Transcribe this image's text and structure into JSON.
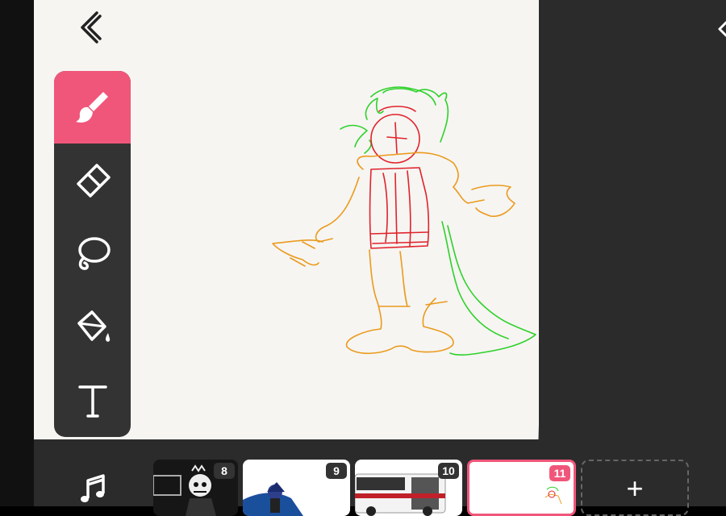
{
  "colors": {
    "accent": "#f0567a",
    "toolbar": "#333333",
    "panel": "#2b2b2b",
    "canvas": "#f6f5f2"
  },
  "navigation": {
    "back_icon": "chevron-left-icon",
    "panel_toggle_icon": "chevron-left-icon"
  },
  "toolbar": {
    "tools": [
      {
        "name": "brush",
        "icon": "brush-icon",
        "active": true
      },
      {
        "name": "eraser",
        "icon": "eraser-icon",
        "active": false
      },
      {
        "name": "lasso",
        "icon": "lasso-icon",
        "active": false
      },
      {
        "name": "fill",
        "icon": "paint-bucket-icon",
        "active": false
      },
      {
        "name": "text",
        "icon": "text-icon",
        "active": false
      }
    ]
  },
  "timeline": {
    "music_icon": "music-note-icon",
    "frames": [
      {
        "number": "8",
        "active": false
      },
      {
        "number": "9",
        "active": false
      },
      {
        "number": "10",
        "active": false
      },
      {
        "number": "11",
        "active": true
      }
    ],
    "add_frame_label": "+"
  }
}
